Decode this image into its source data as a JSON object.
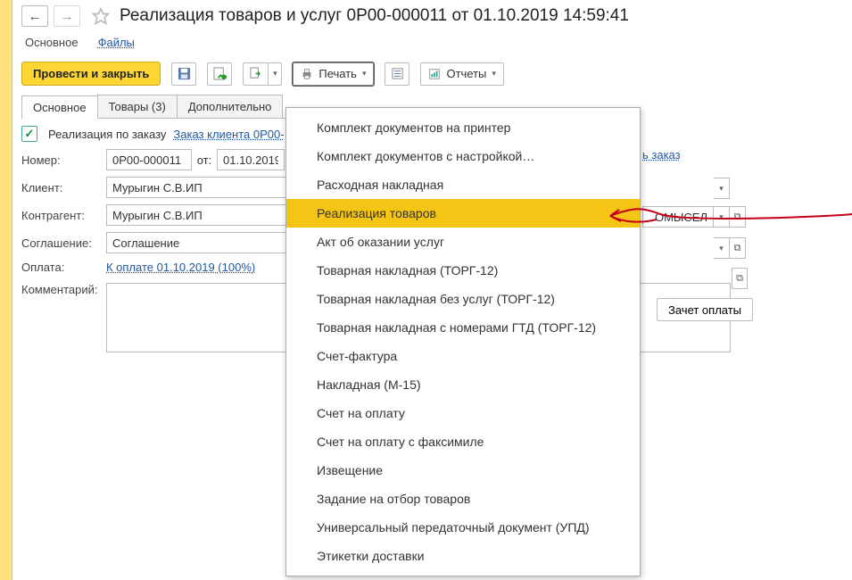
{
  "header": {
    "title": "Реализация товаров и услуг 0Р00-000011 от 01.10.2019 14:59:41"
  },
  "topLinks": {
    "main": "Основное",
    "files": "Файлы"
  },
  "toolbar": {
    "postClose": "Провести и закрыть",
    "print": "Печать",
    "reports": "Отчеты"
  },
  "tabs": {
    "main": "Основное",
    "goods": "Товары (3)",
    "extra": "Дополнительно"
  },
  "orderRow": {
    "checkboxLabel": "Реализация по заказу",
    "orderLink": "Заказ клиента 0Р00-",
    "trailingLink": "ь заказ"
  },
  "fields": {
    "numberLabel": "Номер:",
    "numberValue": "0Р00-000011",
    "fromLabel": "от:",
    "dateValue": "01.10.2019",
    "clientLabel": "Клиент:",
    "clientValue": "Мурыгин С.В.ИП",
    "counterpartyLabel": "Контрагент:",
    "counterpartyValue": "Мурыгин С.В.ИП",
    "agreementLabel": "Соглашение:",
    "agreementValue": "Соглашение",
    "paymentLabel": "Оплата:",
    "paymentLink": "К оплате 01.10.2019 (100%)",
    "commentLabel": "Комментарий:",
    "offsetBtn": "Зачет оплаты",
    "rightField": "ОМЫСЕЛ"
  },
  "printMenu": {
    "items": [
      "Комплект документов на принтер",
      "Комплект документов с настройкой…",
      "Расходная накладная",
      "Реализация товаров",
      "Акт об оказании услуг",
      "Товарная накладная (ТОРГ-12)",
      "Товарная накладная без услуг (ТОРГ-12)",
      "Товарная накладная с номерами ГТД (ТОРГ-12)",
      "Счет-фактура",
      "Накладная (М-15)",
      "Счет на оплату",
      "Счет на оплату с факсимиле",
      "Извещение",
      "Задание на отбор товаров",
      "Универсальный передаточный документ (УПД)",
      "Этикетки доставки"
    ],
    "highlightedIndex": 3
  }
}
